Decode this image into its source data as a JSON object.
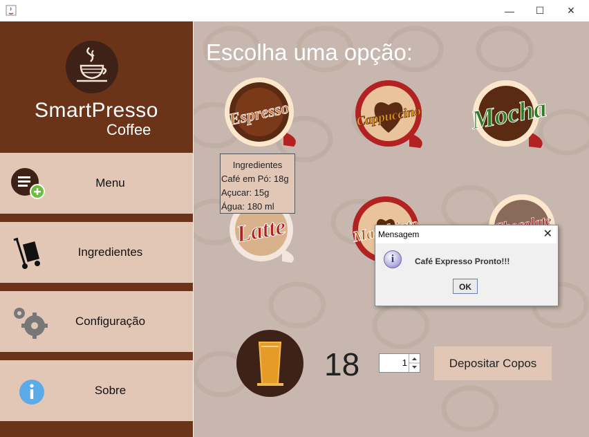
{
  "window": {
    "minimize": "—",
    "maximize": "☐",
    "close": "✕"
  },
  "logo": {
    "name": "SmartPresso",
    "sub": "Coffee"
  },
  "sidebar": {
    "items": [
      {
        "label": "Menu",
        "icon": "menu-add-icon"
      },
      {
        "label": "Ingredientes",
        "icon": "hand-truck-icon"
      },
      {
        "label": "Configuração",
        "icon": "gears-icon"
      },
      {
        "label": "Sobre",
        "icon": "info-icon"
      }
    ]
  },
  "main": {
    "heading": "Escolha uma opção:",
    "drinks": [
      "Espresso",
      "Cappuccino",
      "Mocha",
      "Latte",
      "Macchiato",
      "Chocolate"
    ]
  },
  "tooltip": {
    "title": "Ingredientes",
    "lines": [
      "Café em Pó: 18g",
      "Açucar: 15g",
      "Água: 180 ml"
    ]
  },
  "dialog": {
    "title": "Mensagem",
    "message": "Café Expresso Pronto!!!",
    "ok": "OK",
    "close": "✕"
  },
  "cups": {
    "count": "18",
    "spinner_value": "1",
    "deposit_label": "Depositar Copos"
  },
  "colors": {
    "sidebar": "#6b3419",
    "button": "#e2c6b6",
    "main_bg": "#c7b7ae"
  }
}
